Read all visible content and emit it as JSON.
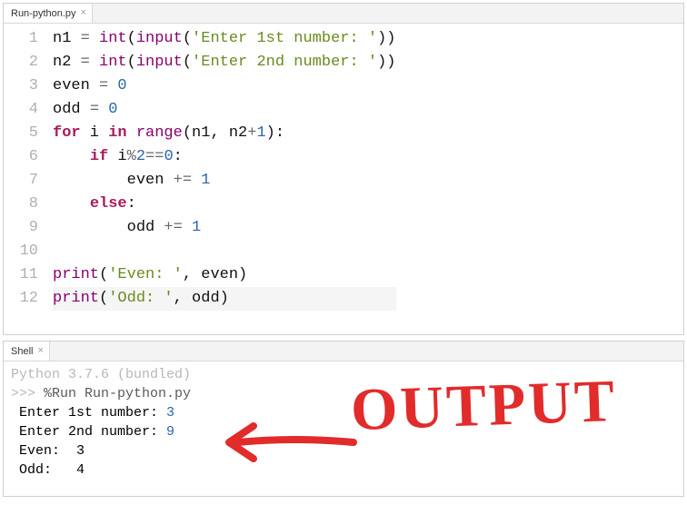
{
  "editor": {
    "tab_label": "Run-python.py",
    "lines": [
      {
        "n": "1",
        "tokens": [
          {
            "t": "n1",
            "c": "var"
          },
          {
            "t": " ",
            "c": "plain"
          },
          {
            "t": "=",
            "c": "op"
          },
          {
            "t": " ",
            "c": "plain"
          },
          {
            "t": "int",
            "c": "builtin"
          },
          {
            "t": "(",
            "c": "plain"
          },
          {
            "t": "input",
            "c": "builtin"
          },
          {
            "t": "(",
            "c": "plain"
          },
          {
            "t": "'Enter 1st number: '",
            "c": "str"
          },
          {
            "t": "))",
            "c": "plain"
          }
        ]
      },
      {
        "n": "2",
        "tokens": [
          {
            "t": "n2",
            "c": "var"
          },
          {
            "t": " ",
            "c": "plain"
          },
          {
            "t": "=",
            "c": "op"
          },
          {
            "t": " ",
            "c": "plain"
          },
          {
            "t": "int",
            "c": "builtin"
          },
          {
            "t": "(",
            "c": "plain"
          },
          {
            "t": "input",
            "c": "builtin"
          },
          {
            "t": "(",
            "c": "plain"
          },
          {
            "t": "'Enter 2nd number: '",
            "c": "str"
          },
          {
            "t": "))",
            "c": "plain"
          }
        ]
      },
      {
        "n": "3",
        "tokens": [
          {
            "t": "even",
            "c": "var"
          },
          {
            "t": " ",
            "c": "plain"
          },
          {
            "t": "=",
            "c": "op"
          },
          {
            "t": " ",
            "c": "plain"
          },
          {
            "t": "0",
            "c": "num"
          }
        ]
      },
      {
        "n": "4",
        "tokens": [
          {
            "t": "odd",
            "c": "var"
          },
          {
            "t": " ",
            "c": "plain"
          },
          {
            "t": "=",
            "c": "op"
          },
          {
            "t": " ",
            "c": "plain"
          },
          {
            "t": "0",
            "c": "num"
          }
        ]
      },
      {
        "n": "5",
        "tokens": [
          {
            "t": "for",
            "c": "kw"
          },
          {
            "t": " i ",
            "c": "plain"
          },
          {
            "t": "in",
            "c": "kw"
          },
          {
            "t": " ",
            "c": "plain"
          },
          {
            "t": "range",
            "c": "builtin"
          },
          {
            "t": "(n1, n2",
            "c": "plain"
          },
          {
            "t": "+",
            "c": "op"
          },
          {
            "t": "1",
            "c": "num"
          },
          {
            "t": "):",
            "c": "plain"
          }
        ]
      },
      {
        "n": "6",
        "tokens": [
          {
            "t": "    ",
            "c": "plain"
          },
          {
            "t": "if",
            "c": "kw"
          },
          {
            "t": " i",
            "c": "plain"
          },
          {
            "t": "%",
            "c": "op"
          },
          {
            "t": "2",
            "c": "num"
          },
          {
            "t": "==",
            "c": "op"
          },
          {
            "t": "0",
            "c": "num"
          },
          {
            "t": ":",
            "c": "plain"
          }
        ]
      },
      {
        "n": "7",
        "tokens": [
          {
            "t": "        even ",
            "c": "plain"
          },
          {
            "t": "+=",
            "c": "op"
          },
          {
            "t": " ",
            "c": "plain"
          },
          {
            "t": "1",
            "c": "num"
          }
        ]
      },
      {
        "n": "8",
        "tokens": [
          {
            "t": "    ",
            "c": "plain"
          },
          {
            "t": "else",
            "c": "kw"
          },
          {
            "t": ":",
            "c": "plain"
          }
        ]
      },
      {
        "n": "9",
        "tokens": [
          {
            "t": "        odd ",
            "c": "plain"
          },
          {
            "t": "+=",
            "c": "op"
          },
          {
            "t": " ",
            "c": "plain"
          },
          {
            "t": "1",
            "c": "num"
          }
        ]
      },
      {
        "n": "10",
        "tokens": []
      },
      {
        "n": "11",
        "tokens": [
          {
            "t": "print",
            "c": "builtin"
          },
          {
            "t": "(",
            "c": "plain"
          },
          {
            "t": "'Even: '",
            "c": "str"
          },
          {
            "t": ", even)",
            "c": "plain"
          }
        ]
      },
      {
        "n": "12",
        "hl": true,
        "tokens": [
          {
            "t": "print",
            "c": "builtin"
          },
          {
            "t": "(",
            "c": "plain"
          },
          {
            "t": "'Odd: '",
            "c": "str"
          },
          {
            "t": ", odd)",
            "c": "plain"
          }
        ]
      }
    ]
  },
  "shell": {
    "tab_label": "Shell",
    "version_line": "Python 3.7.6 (bundled)",
    "prompt": ">>>",
    "run_command": "%Run Run-python.py",
    "output": [
      {
        "text": "Enter 1st number: ",
        "value": "3"
      },
      {
        "text": "Enter 2nd number: ",
        "value": "9"
      },
      {
        "text": "Even:  3"
      },
      {
        "text": "Odd:   4"
      }
    ]
  },
  "annotation": {
    "label": "OUTPUT"
  }
}
